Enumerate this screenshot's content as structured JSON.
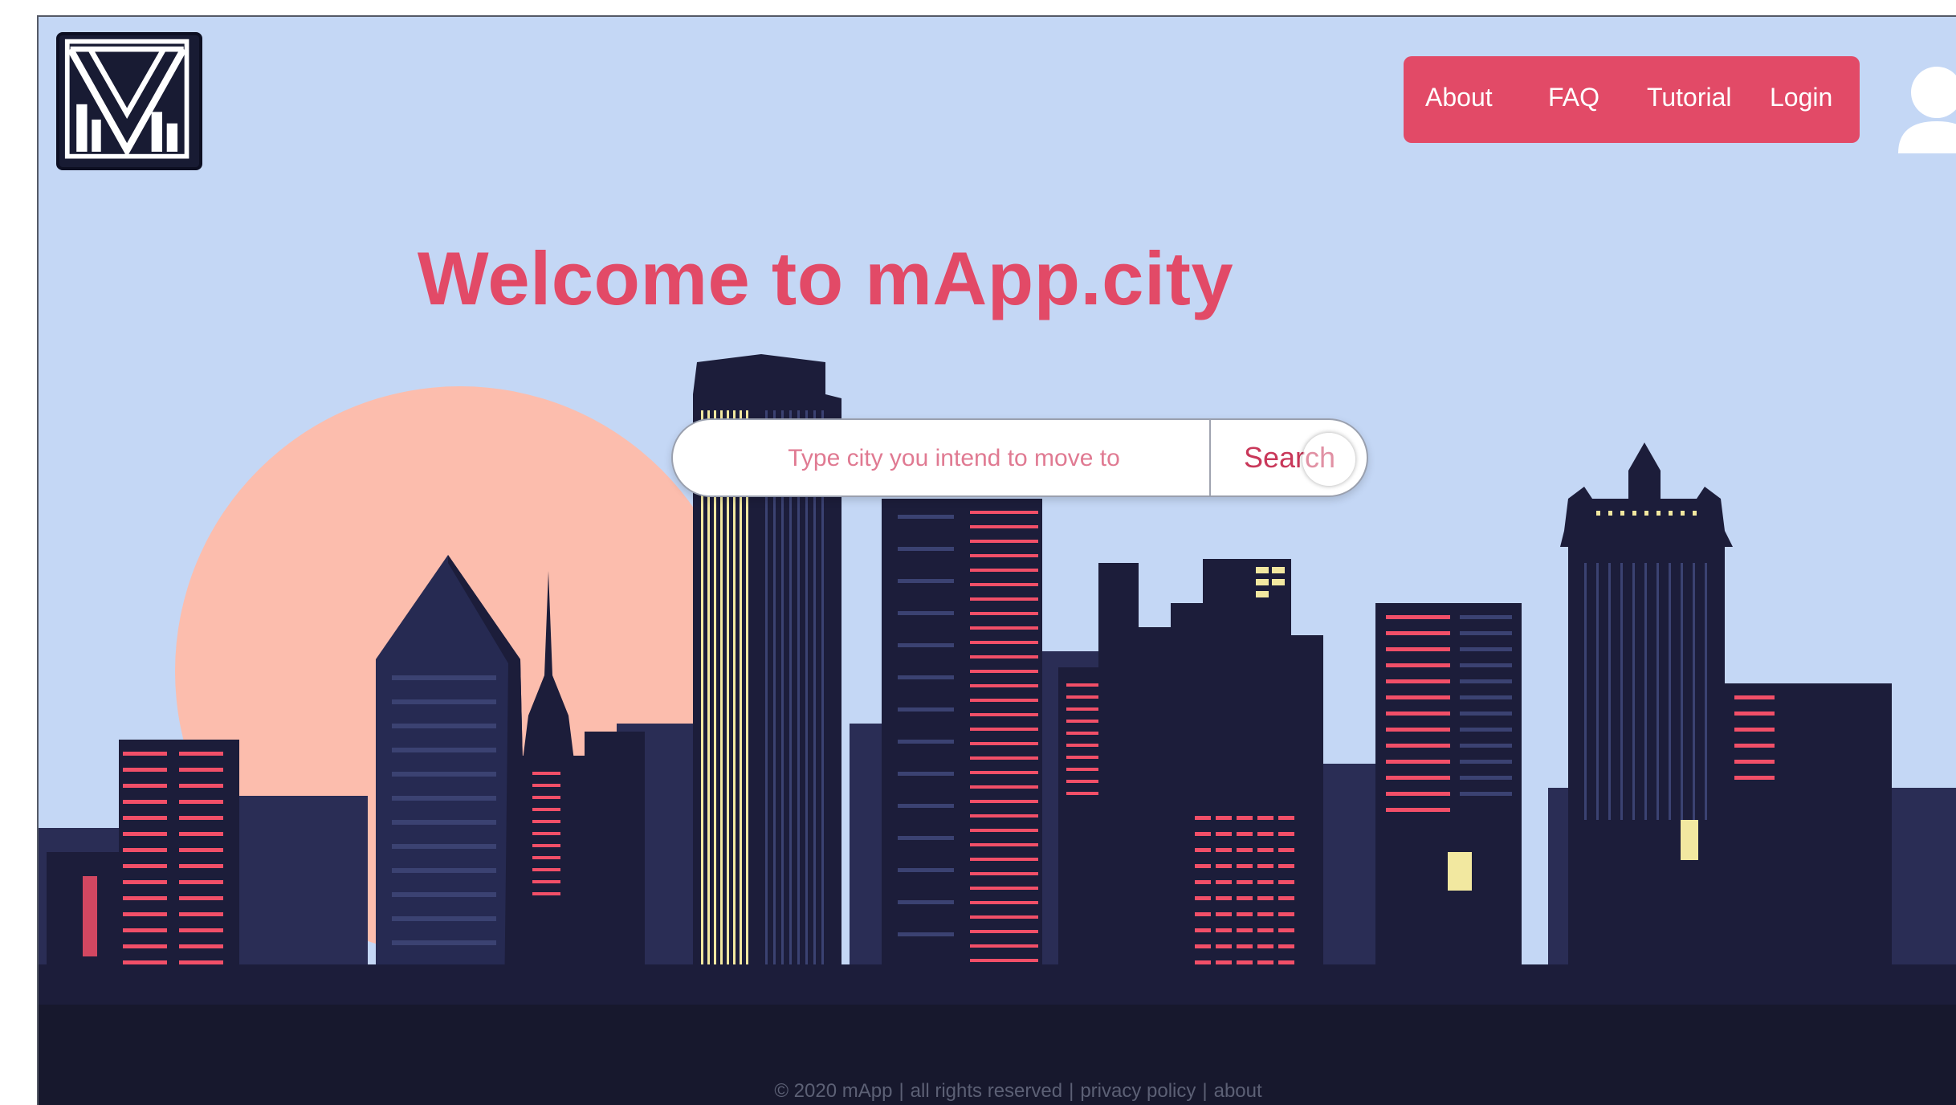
{
  "header": {
    "logo_icon": "triangle-city-logo-icon",
    "nav": {
      "about": "About",
      "faq": "FAQ",
      "tutorial": "Tutorial",
      "login": "Login"
    },
    "user_icon": "user-avatar-icon"
  },
  "hero": {
    "title": "Welcome to mApp.city",
    "search": {
      "placeholder": "Type city you intend to move to",
      "button": "Search"
    }
  },
  "footer": {
    "copyright": "© 2020 mApp",
    "sep": "|",
    "rights": "all rights reserved",
    "privacy": "privacy policy",
    "about": "about"
  },
  "colors": {
    "accent": "#e24a67",
    "sky": "#c4d7f5",
    "sun": "#fcbdad",
    "buildings": "#1c1d3a",
    "ground": "#17182d",
    "window_red": "#f24f68",
    "window_yellow": "#f2e8a0"
  }
}
